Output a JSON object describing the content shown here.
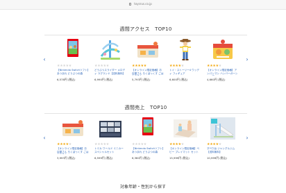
{
  "browser": {
    "url": "toysrus.co.jp"
  },
  "weekly_access": {
    "title": "週間アクセス　TOP10",
    "prev_arrow": "‹",
    "next_arrow": "›",
    "items": [
      {
        "name": "【Nintendo Switchソフト】あつまれ どうぶつの森",
        "price": "6,578円 (税込)",
        "stars": 0,
        "icon": "game-box-icon"
      },
      {
        "name": "どうぶつスライダー メロディ ラグランド【送料無料】",
        "price": "6,990円 (税込)",
        "stars": 0,
        "icon": "slider-toy-icon"
      },
      {
        "name": "【オンライン限定価格】お店屋さん ろくぼっくす ごはんやさん",
        "price": "5,793円 (税込)",
        "stars": 5,
        "icon": "kids-shop-icon"
      },
      {
        "name": "トイ・ストーリー4 ウッディ フィギュア",
        "price": "6,600円 (税込)",
        "stars": 4,
        "icon": "cowboy-figure-icon"
      },
      {
        "name": "【オンライン限定価格】アンパンマン ハンバーガーショップ",
        "price": "4,660円 (税込)",
        "stars": 4,
        "icon": "playset-icon"
      }
    ]
  },
  "weekly_sales": {
    "title": "週間売上　TOP10",
    "prev_arrow": "‹",
    "next_arrow": "›",
    "items": [
      {
        "name": "【オンライン限定価格】お店屋さん ろくぼっくす ごはんやさん",
        "price": "3,993円 (税込)",
        "stars": 4,
        "icon": "kids-shop-icon"
      },
      {
        "name": "トミカ ワールド ミニカー スペシャルセット",
        "price": "6,599円 (税込)",
        "stars": 0,
        "icon": "minicar-set-icon"
      },
      {
        "name": "【Nintendo Switchソフト】あつまれ どうぶつの森",
        "price": "6,380円 (税込)",
        "stars": 0,
        "icon": "game-box-icon"
      },
      {
        "name": "【オンライン限定価格】ベビー プレイマット セット",
        "price": "15,999円 (税込)",
        "stars": 4,
        "icon": "play-mat-icon"
      },
      {
        "name": "すべり台 ジャングルジム【送料無料】",
        "price": "10,999円 (税込)",
        "stars": 4,
        "icon": "slide-toy-icon"
      }
    ]
  },
  "bottom_section": {
    "title": "対象年齢・性別から探す"
  }
}
